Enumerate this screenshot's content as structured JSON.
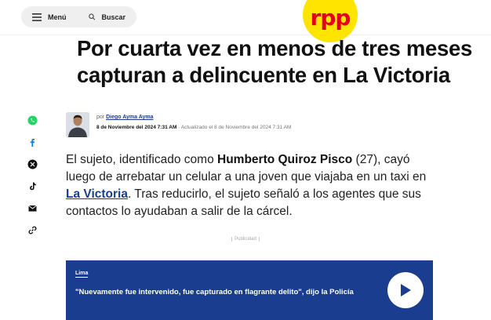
{
  "header": {
    "menu_label": "Menú",
    "search_label": "Buscar",
    "logo_text": "RPP",
    "brand_color": "#fde500",
    "brand_text_color": "#e3001b"
  },
  "article": {
    "title": "Por cuarta vez en menos de tres meses capturan a delincuente en La Victoria",
    "byline_prefix": "por",
    "author": "Diego Ayma Ayma",
    "published": "8 de Noviembre del 2024 7:31 AM",
    "updated": "· Actualizado el 8 de Noviembre del 2024 7:31 AM",
    "lead": {
      "part1": "El sujeto, identificado como ",
      "name": "Humberto Quiroz Pisco",
      "part2": " (27), cayó luego de arrebatar un celular a una joven que viajaba en un taxi en ",
      "link": "La Victoria",
      "part3": ". Tras reducirlo, el sujeto señaló a los agentes que sus contactos lo ayudaban a salir de la cárcel."
    }
  },
  "share_icons": [
    "whatsapp-icon",
    "facebook-icon",
    "x-icon",
    "tiktok-icon",
    "email-icon",
    "link-icon"
  ],
  "ad": {
    "label": "Publicidad"
  },
  "related_card": {
    "section": "Lima",
    "headline": "\"Nuevamente fue intervenido, fue capturado en flagrante delito\", dijo la Policía",
    "bg_color": "#1b3d8f"
  }
}
